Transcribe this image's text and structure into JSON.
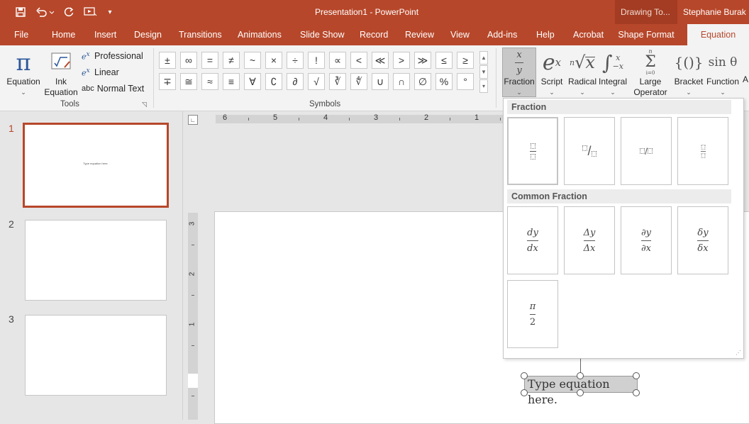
{
  "window": {
    "title": "Presentation1  -  PowerPoint",
    "context_label": "Drawing To...",
    "user": "Stephanie Burak"
  },
  "qat": {
    "save_icon": "save-icon",
    "undo_icon": "undo-icon",
    "redo_icon": "redo-icon",
    "present_icon": "present-from-beginning-icon",
    "customize_icon": "customize-qat-icon"
  },
  "tabs": [
    "File",
    "Home",
    "Insert",
    "Design",
    "Transitions",
    "Animations",
    "Slide Show",
    "Record",
    "Review",
    "View",
    "Add-ins",
    "Help",
    "Acrobat",
    "Shape Format",
    "Equation"
  ],
  "active_tab": "Equation",
  "accent_color": "#b7472a",
  "tools": {
    "group_label": "Tools",
    "equation_label": "Equation",
    "ink_label_1": "Ink",
    "ink_label_2": "Equation",
    "professional": "Professional",
    "linear": "Linear",
    "normal_text_prefix": "abc",
    "normal_text": "Normal Text"
  },
  "symbols": {
    "group_label": "Symbols",
    "row1": [
      "±",
      "∞",
      "=",
      "≠",
      "~",
      "×",
      "÷",
      "!",
      "∝",
      "<",
      "≪",
      ">",
      "≫",
      "≤",
      "≥"
    ],
    "row2": [
      "∓",
      "≅",
      "≈",
      "≡",
      "∀",
      "∁",
      "∂",
      "√",
      "∛",
      "∜",
      "∪",
      "∩",
      "∅",
      "%",
      "°"
    ]
  },
  "structures": {
    "fraction": "Fraction",
    "script": "Script",
    "radical": "Radical",
    "integral": "Integral",
    "large_operator_1": "Large",
    "large_operator_2": "Operator",
    "bracket": "Bracket",
    "function": "Function",
    "overflow": "A"
  },
  "gallery": {
    "section1": "Fraction",
    "section2": "Common Fraction",
    "common": [
      {
        "num": "dy",
        "den": "dx"
      },
      {
        "num": "Δy",
        "den": "Δx"
      },
      {
        "num": "∂y",
        "den": "∂x"
      },
      {
        "num": "δy",
        "den": "δx"
      },
      {
        "num": "π",
        "den": "2"
      }
    ]
  },
  "slides": {
    "numbers": [
      "1",
      "2",
      "3"
    ],
    "thumb1_text": "Type equation here."
  },
  "ruler": {
    "h": [
      "6",
      "5",
      "4",
      "3",
      "2",
      "1"
    ],
    "v": [
      "3",
      "2",
      "1"
    ]
  },
  "equation_placeholder": "Type equation here."
}
